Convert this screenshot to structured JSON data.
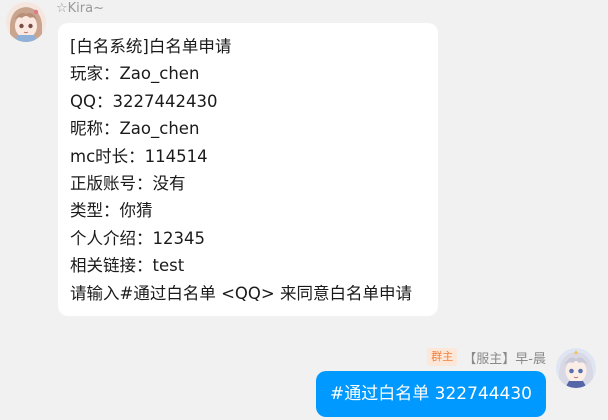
{
  "colors": {
    "background": "#f1f1f1",
    "incoming_bubble": "#ffffff",
    "outgoing_bubble": "#0099ff",
    "badge_text": "#f2803b",
    "badge_bg": "#fde7d8"
  },
  "incoming_message": {
    "sender": "☆Kira~",
    "avatar_icon": "anime-avatar",
    "lines": [
      "[白名系统]白名单申请",
      "玩家：Zao_chen",
      "QQ：3227442430",
      "昵称：Zao_chen",
      "mc时长：114514",
      "正版账号：没有",
      "类型：你猜",
      "个人介绍：12345",
      "相关链接：test",
      "请输入#通过白名单 <QQ> 来同意白名单申请"
    ]
  },
  "outgoing_message": {
    "badge": "群主",
    "sender": "【服主】早-晨",
    "avatar_icon": "anime-avatar",
    "text": "#通过白名单 322744430"
  }
}
